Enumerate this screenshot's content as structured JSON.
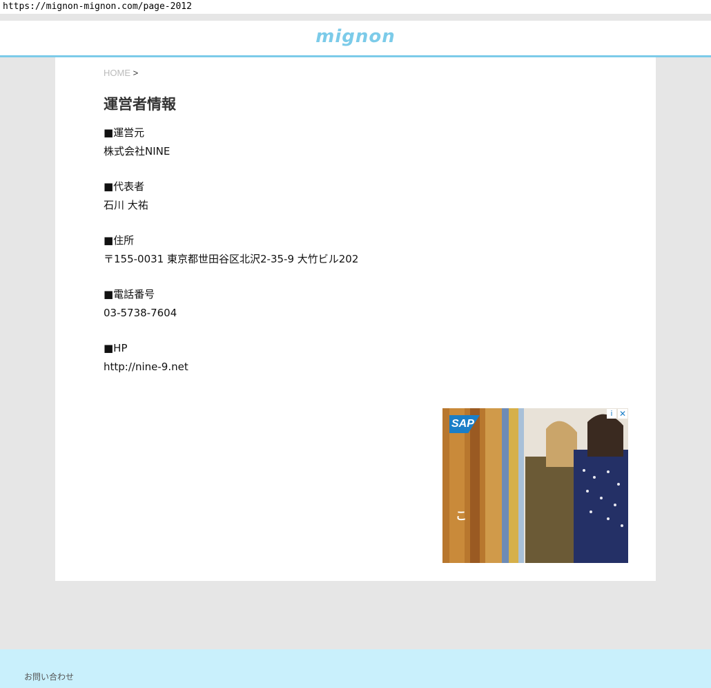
{
  "browser": {
    "url": "https://mignon-mignon.com/page-2012"
  },
  "header": {
    "logo": "mignon"
  },
  "breadcrumb": {
    "home": "HOME",
    "separator": ">"
  },
  "page": {
    "title": "運営者情報",
    "sections": [
      {
        "label": "■運営元",
        "value": "株式会社NINE"
      },
      {
        "label": "■代表者",
        "value": "石川 大祐"
      },
      {
        "label": "■住所",
        "value": "〒155-0031 東京都世田谷区北沢2-35-9 大竹ビル202"
      },
      {
        "label": "■電話番号",
        "value": "03-5738-7604"
      },
      {
        "label": "■HP",
        "value": "http://nine-9.net"
      }
    ]
  },
  "ad": {
    "logo_text": "SAP",
    "overlay_text": "こ",
    "info_icon": "i",
    "close_icon": "✕"
  },
  "footer": {
    "contact": "お問い合わせ"
  },
  "colors": {
    "accent": "#7ccbe9",
    "footer_bg": "#c9f0fc",
    "page_bg": "#e6e6e6"
  }
}
